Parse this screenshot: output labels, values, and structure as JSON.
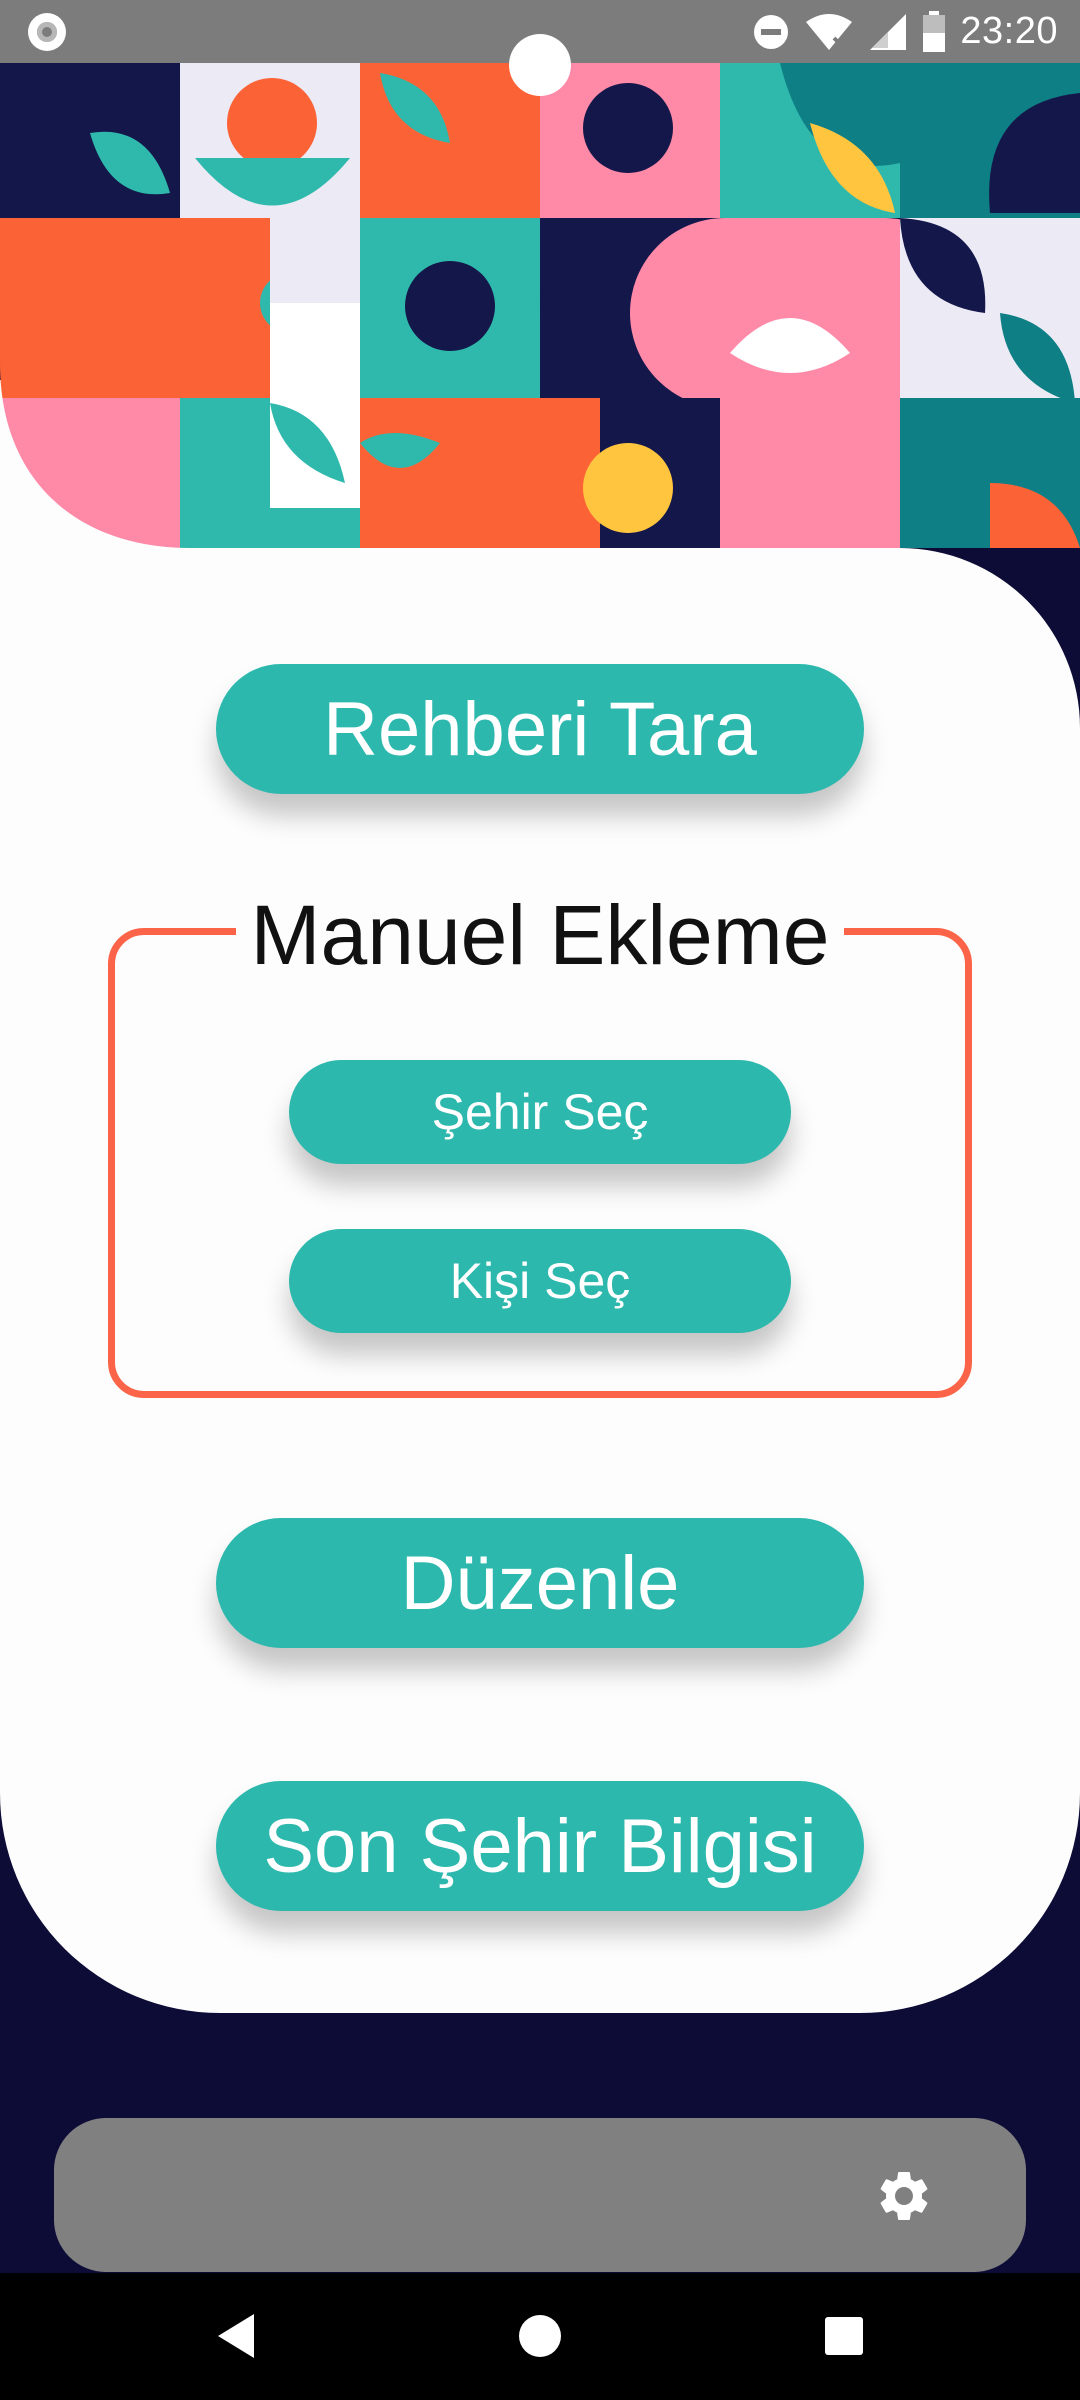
{
  "status_bar": {
    "time": "23:20",
    "icons": [
      "record-icon",
      "do-not-disturb-icon",
      "wifi-icon",
      "cellular-signal-icon",
      "battery-icon"
    ]
  },
  "main": {
    "scan_contacts_label": "Rehberi Tara",
    "manual_section": {
      "title": "Manuel Ekleme",
      "select_city_label": "Şehir Seç",
      "select_person_label": "Kişi Seç"
    },
    "edit_label": "Düzenle",
    "last_city_info_label": "Son Şehir Bilgisi"
  },
  "bottom_bar": {
    "icons": [
      "settings-icon"
    ]
  },
  "nav_bar": {
    "icons": [
      "back-icon",
      "home-icon",
      "recents-icon"
    ]
  },
  "colors": {
    "accent": "#2db8ad",
    "frame": "#fb6448",
    "background": "#0d0c36",
    "card": "#fdfdfd",
    "bottom_bar": "#808080"
  }
}
